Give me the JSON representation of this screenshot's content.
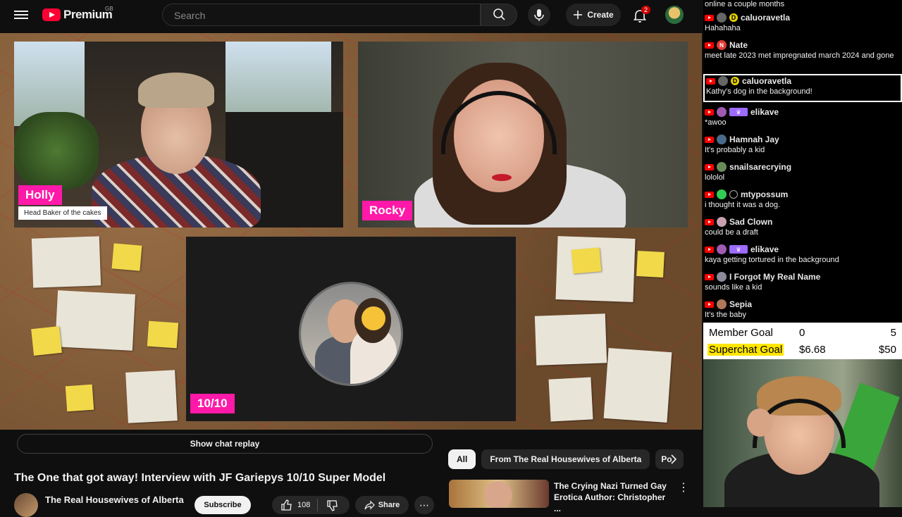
{
  "header": {
    "logo_text": "Premium",
    "logo_region": "GB",
    "search_placeholder": "Search",
    "create_label": "Create",
    "notification_count": "2"
  },
  "video": {
    "participants": [
      {
        "name": "Holly",
        "subtitle": "Head Baker of the cakes"
      },
      {
        "name": "Rocky"
      },
      {
        "name": "10/10"
      }
    ]
  },
  "below_video": {
    "chat_replay_label": "Show chat replay",
    "title": "The One that got away! Interview with JF Gariepys 10/10 Super Model",
    "channel_name": "The Real Housewives of Alberta",
    "subscribe_label": "Subscribe",
    "like_count": "108",
    "share_label": "Share"
  },
  "recommendations": {
    "chips": [
      "All",
      "From The Real Housewives of Alberta",
      "Po"
    ],
    "active_chip": "All",
    "items": [
      {
        "title": "The Crying Nazi Turned Gay Erotica Author: Christopher ..."
      }
    ]
  },
  "chat": {
    "top_partial_text": "online a couple months",
    "messages": [
      {
        "author": "caluoravetla",
        "text": "Hahahaha",
        "avatar_color": "#666666",
        "badge": "d"
      },
      {
        "author": "Nate",
        "text": "meet late 2023 met impregnated march 2024 and gone",
        "avatar_color": "#e53935",
        "avatar_letter": "N"
      },
      {
        "author": "caluoravetla",
        "text": "Kathy's dog in the background!",
        "avatar_color": "#666666",
        "badge": "d",
        "highlighted": true
      },
      {
        "author": "elikave",
        "text": "*awoo",
        "avatar_color": "#a05ab0",
        "badge": "crown"
      },
      {
        "author": "Hamnah Jay",
        "text": "It's probably a kid",
        "avatar_color": "#4a6a8a"
      },
      {
        "author": "snailsarecrying",
        "text": "lololol",
        "avatar_color": "#6a8a5a"
      },
      {
        "author": "mtypossum",
        "text": "i thought it was a dog.",
        "avatar_color": "#33cc55",
        "badge": "person"
      },
      {
        "author": "Sad Clown",
        "text": "could be a draft",
        "avatar_color": "#c8a0b0"
      },
      {
        "author": "elikave",
        "text": "kaya getting tortured in the background",
        "avatar_color": "#a05ab0",
        "badge": "crown"
      },
      {
        "author": "I Forgot My Real Name",
        "text": "sounds like a kid",
        "avatar_color": "#8a8a9a"
      },
      {
        "author": "Sepia",
        "text": "It's the baby",
        "avatar_color": "#b07a5a"
      }
    ]
  },
  "goals": {
    "member": {
      "label": "Member Goal",
      "current": "0",
      "target": "5"
    },
    "superchat": {
      "label": "Superchat Goal",
      "current": "$6.68",
      "target": "$50"
    }
  },
  "colors": {
    "accent_pink": "#ff19a8",
    "youtube_red": "#ff0033",
    "goal_highlight": "#ffe600"
  }
}
